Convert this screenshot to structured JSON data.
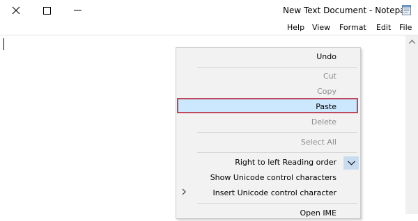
{
  "window": {
    "title": "New Text Document - Notepad",
    "controls": [
      "close-icon",
      "maximize-icon",
      "minimize-icon"
    ]
  },
  "menubar": {
    "file": "File",
    "edit": "Edit",
    "format": "Format",
    "view": "View",
    "help": "Help"
  },
  "editor": {
    "content": ""
  },
  "context_menu": {
    "undo": "Undo",
    "cut": "Cut",
    "copy": "Copy",
    "paste": "Paste",
    "delete": "Delete",
    "select_all": "Select All",
    "rtl": "Right to left Reading order",
    "show_unicode": "Show Unicode control characters",
    "insert_unicode": "Insert Unicode control character",
    "open_ime": "Open IME",
    "disabled_items": [
      "Cut",
      "Copy",
      "Delete",
      "Select All"
    ],
    "checked_item": "Right to left Reading order",
    "highlighted_item": "Paste"
  },
  "colors": {
    "highlight_fill": "#cce8ff",
    "highlight_border": "#c0485c",
    "menu_background": "#f2f2f2",
    "disabled_text": "#8c8c8c"
  }
}
